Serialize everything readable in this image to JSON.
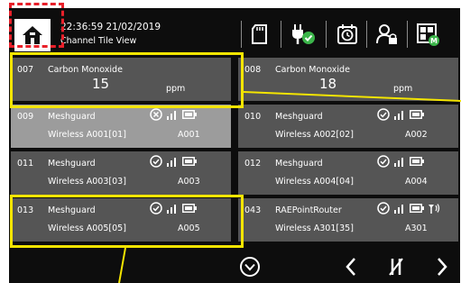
{
  "header": {
    "datetime": "22:36:59 21/02/2019",
    "view_title": "Channel Tile View"
  },
  "tiles": [
    {
      "num": "007",
      "name": "Carbon Monoxide",
      "value": "15",
      "unit": "ppm"
    },
    {
      "num": "008",
      "name": "Carbon Monoxide",
      "value": "18",
      "unit": "ppm"
    },
    {
      "num": "009",
      "name": "Meshguard",
      "sub": "Wireless A001[01]",
      "id": "A001",
      "status": "offline"
    },
    {
      "num": "010",
      "name": "Meshguard",
      "sub": "Wireless A002[02]",
      "id": "A002",
      "status": "ok"
    },
    {
      "num": "011",
      "name": "Meshguard",
      "sub": "Wireless A003[03]",
      "id": "A003",
      "status": "ok"
    },
    {
      "num": "012",
      "name": "Meshguard",
      "sub": "Wireless A004[04]",
      "id": "A004",
      "status": "ok"
    },
    {
      "num": "013",
      "name": "Meshguard",
      "sub": "Wireless A005[05]",
      "id": "A005",
      "status": "ok"
    },
    {
      "num": "043",
      "name": "RAEPointRouter",
      "sub": "Wireless A301[35]",
      "id": "A301",
      "status": "ok"
    }
  ],
  "colors": {
    "background": "#0d0d0d",
    "tile": "#555555",
    "tile_offline": "#9c9c9c",
    "accent_green": "#3bb54a",
    "annotation_yellow": "#f4e500",
    "annotation_red": "#e8202a"
  },
  "icons": {
    "home": "home-icon",
    "sd_card": "sd-card-icon",
    "power": "power-plug-icon",
    "alarm": "alarm-clock-icon",
    "user": "user-lock-icon",
    "view": "tile-view-icon",
    "scroll_down": "circle-chevron-down-icon",
    "prev": "chevron-left-icon",
    "mute": "mute-icon",
    "next": "chevron-right-icon"
  }
}
